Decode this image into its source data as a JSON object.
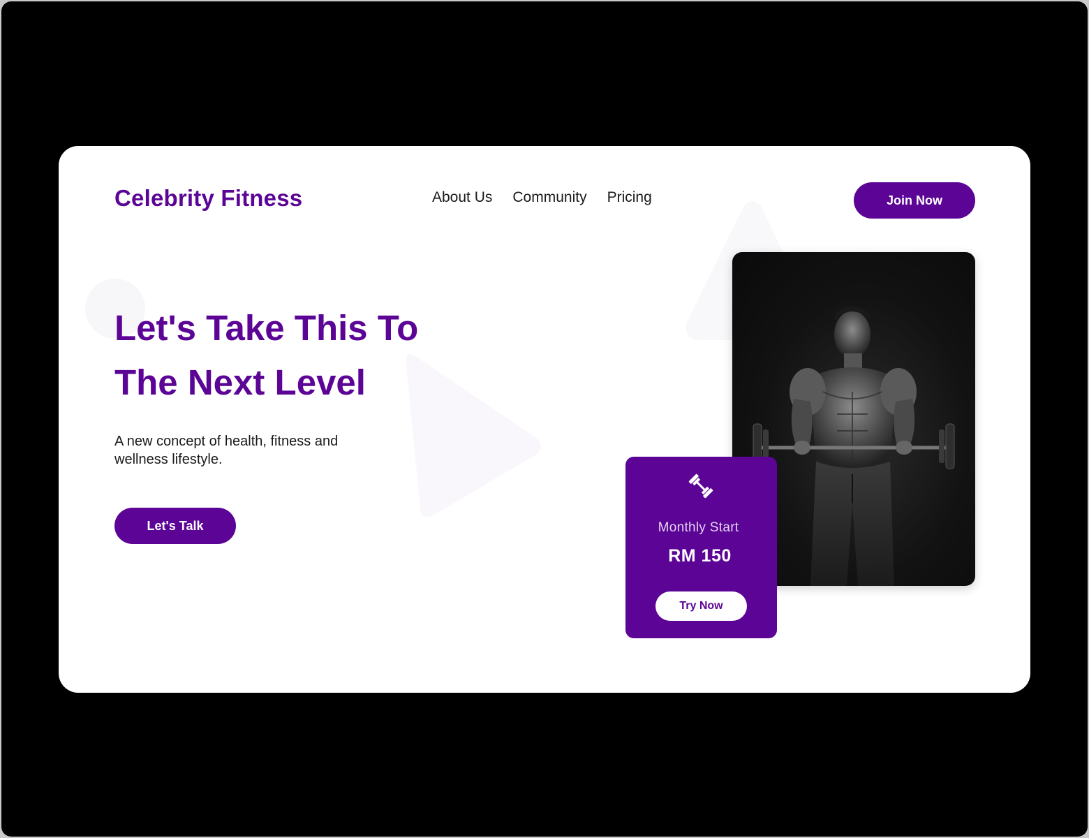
{
  "brand": {
    "name": "Celebrity Fitness",
    "accent_color": "#5b0496"
  },
  "nav": {
    "items": [
      {
        "label": "About Us"
      },
      {
        "label": "Community"
      },
      {
        "label": "Pricing"
      }
    ],
    "cta_label": "Join Now"
  },
  "hero": {
    "headline_line1": "Let's Take This To",
    "headline_line2": "The Next Level",
    "subtext": "A new concept of health, fitness and wellness lifestyle.",
    "cta_label": "Let's Talk"
  },
  "pricing_card": {
    "icon": "dumbbell-icon",
    "label": "Monthly Start",
    "price": "RM 150",
    "cta_label": "Try Now"
  },
  "image": {
    "subject": "bodybuilder-lifting-barbell-photo"
  }
}
